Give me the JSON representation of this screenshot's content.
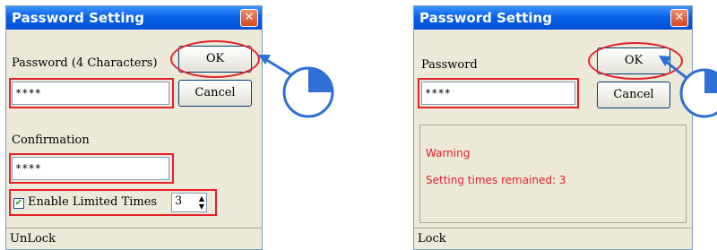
{
  "left_dialog": {
    "title": "Password Setting",
    "password_label": "Password (4 Characters)",
    "password_value": "****",
    "ok_label": "OK",
    "cancel_label": "Cancel",
    "confirmation_label": "Confirmation",
    "confirmation_value": "****",
    "limited_times_label": "Enable Limited Times",
    "limited_times_checked": true,
    "limited_times_value": "3",
    "status_text": "UnLock"
  },
  "right_dialog": {
    "title": "Password Setting",
    "password_label": "Password",
    "password_value": "****",
    "ok_label": "OK",
    "cancel_label": "Cancel",
    "warning_title": "Warning",
    "warning_message": "Setting times remained: 3",
    "status_text": "Lock"
  },
  "colors": {
    "highlight": "#e4212b",
    "title_bar": "#0a61e6",
    "pointer": "#2f6fd6"
  },
  "icons": {
    "close": "close-icon",
    "pointer": "click-pointer-icon",
    "check": "check-icon"
  }
}
